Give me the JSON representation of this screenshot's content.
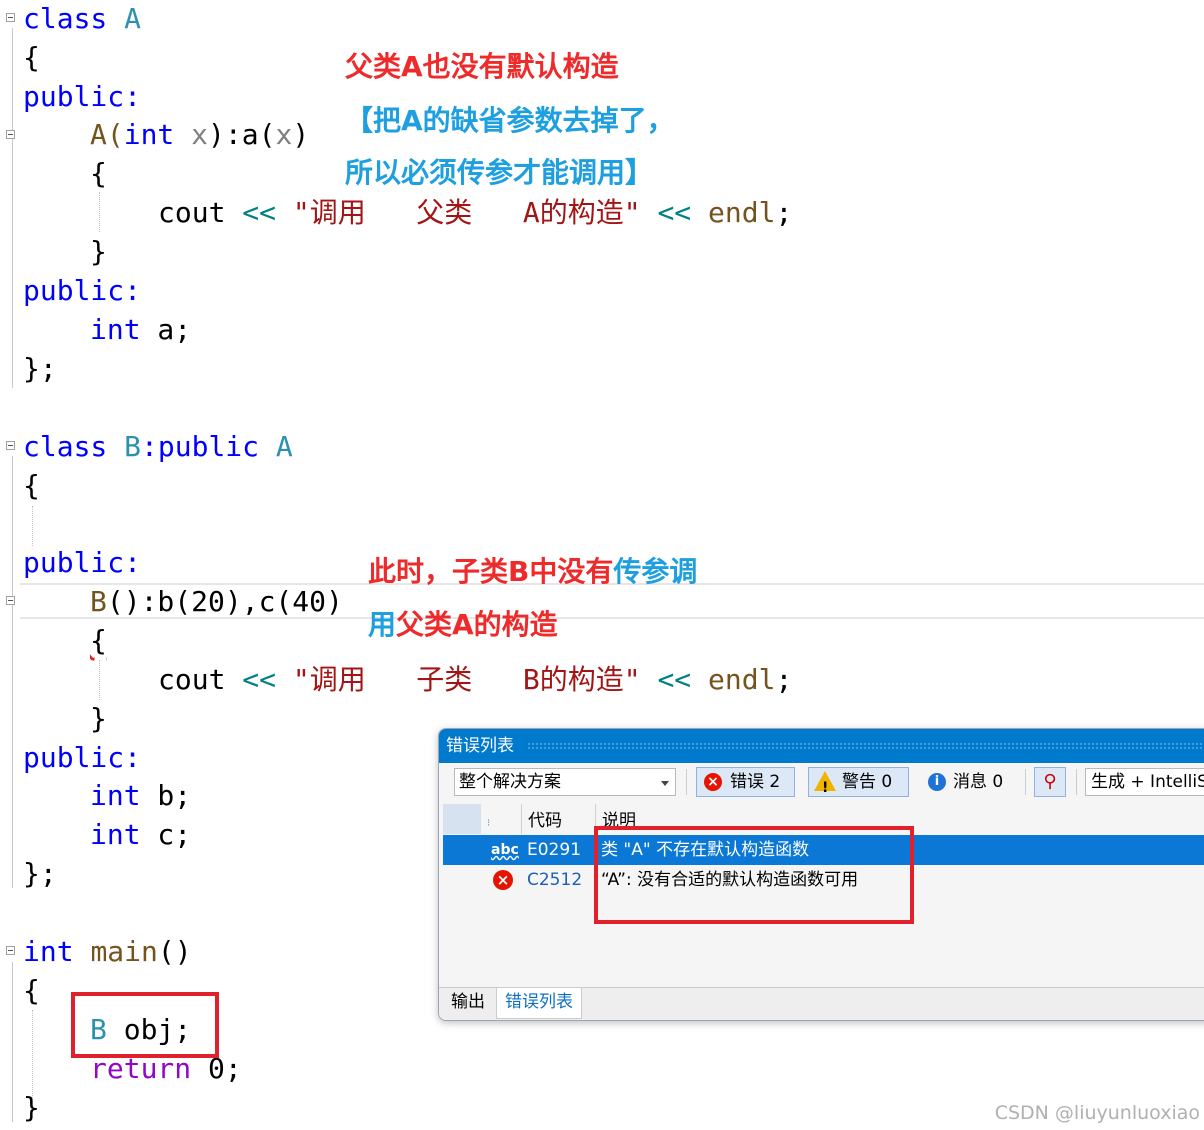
{
  "code": {
    "l1_kw": "class",
    "l1_cls": "A",
    "brace_open": "{",
    "brace_close": "}",
    "class_end": "};",
    "public": "public:",
    "ctorA_name": "A(",
    "ctorA_kw": "int",
    "ctorA_param": "x",
    "ctorA_rest1": "):a(",
    "ctorA_rest2": ")",
    "cout": "cout",
    "shift": "<<",
    "strA": "\"调用   父类   A的构造\"",
    "endl": "endl",
    "semi": ";",
    "int_kw": "int",
    "var_a": " a;",
    "l2_kw": "class",
    "l2_cls": "B",
    "l2_mid": ":public ",
    "l2_base": "A",
    "ctorB_name": "B",
    "ctorB_rest": "():b(20),c(40)",
    "strB": "\"调用   子类   B的构造\"",
    "var_b": " b;",
    "var_c": " c;",
    "main_kw": "int",
    "main_fn": "main",
    "main_paren": "()",
    "obj_cls": "B",
    "obj_var": " obj;",
    "return_kw": "return",
    "return_val": " 0;"
  },
  "annotations": {
    "a1_line1": "父类A也没有默认构造",
    "a1_line2": "【把A的缺省参数去掉了，",
    "a1_line3": "所以必须传参才能调用】",
    "a2_line1_red": "此时，子类B中没有",
    "a2_line1_blue": "传参调",
    "a2_line2_blue": "用",
    "a2_line2_red": "父类A的构造"
  },
  "error_list": {
    "title": "错误列表",
    "scope": "整个解决方案",
    "errors_label": "错误 2",
    "warnings_label": "警告 0",
    "messages_label": "消息 0",
    "build_filter": "生成 + IntelliSense",
    "col_code": "代码",
    "col_desc": "说明",
    "rows": [
      {
        "icon": "abc",
        "code": "E0291",
        "desc": "类 \"A\" 不存在默认构造函数"
      },
      {
        "icon": "error-icon",
        "code": "C2512",
        "desc": "“A”: 没有合适的默认构造函数可用"
      }
    ],
    "tab_output": "输出",
    "tab_errors": "错误列表"
  },
  "watermark": "CSDN @liuyunluoxiao"
}
